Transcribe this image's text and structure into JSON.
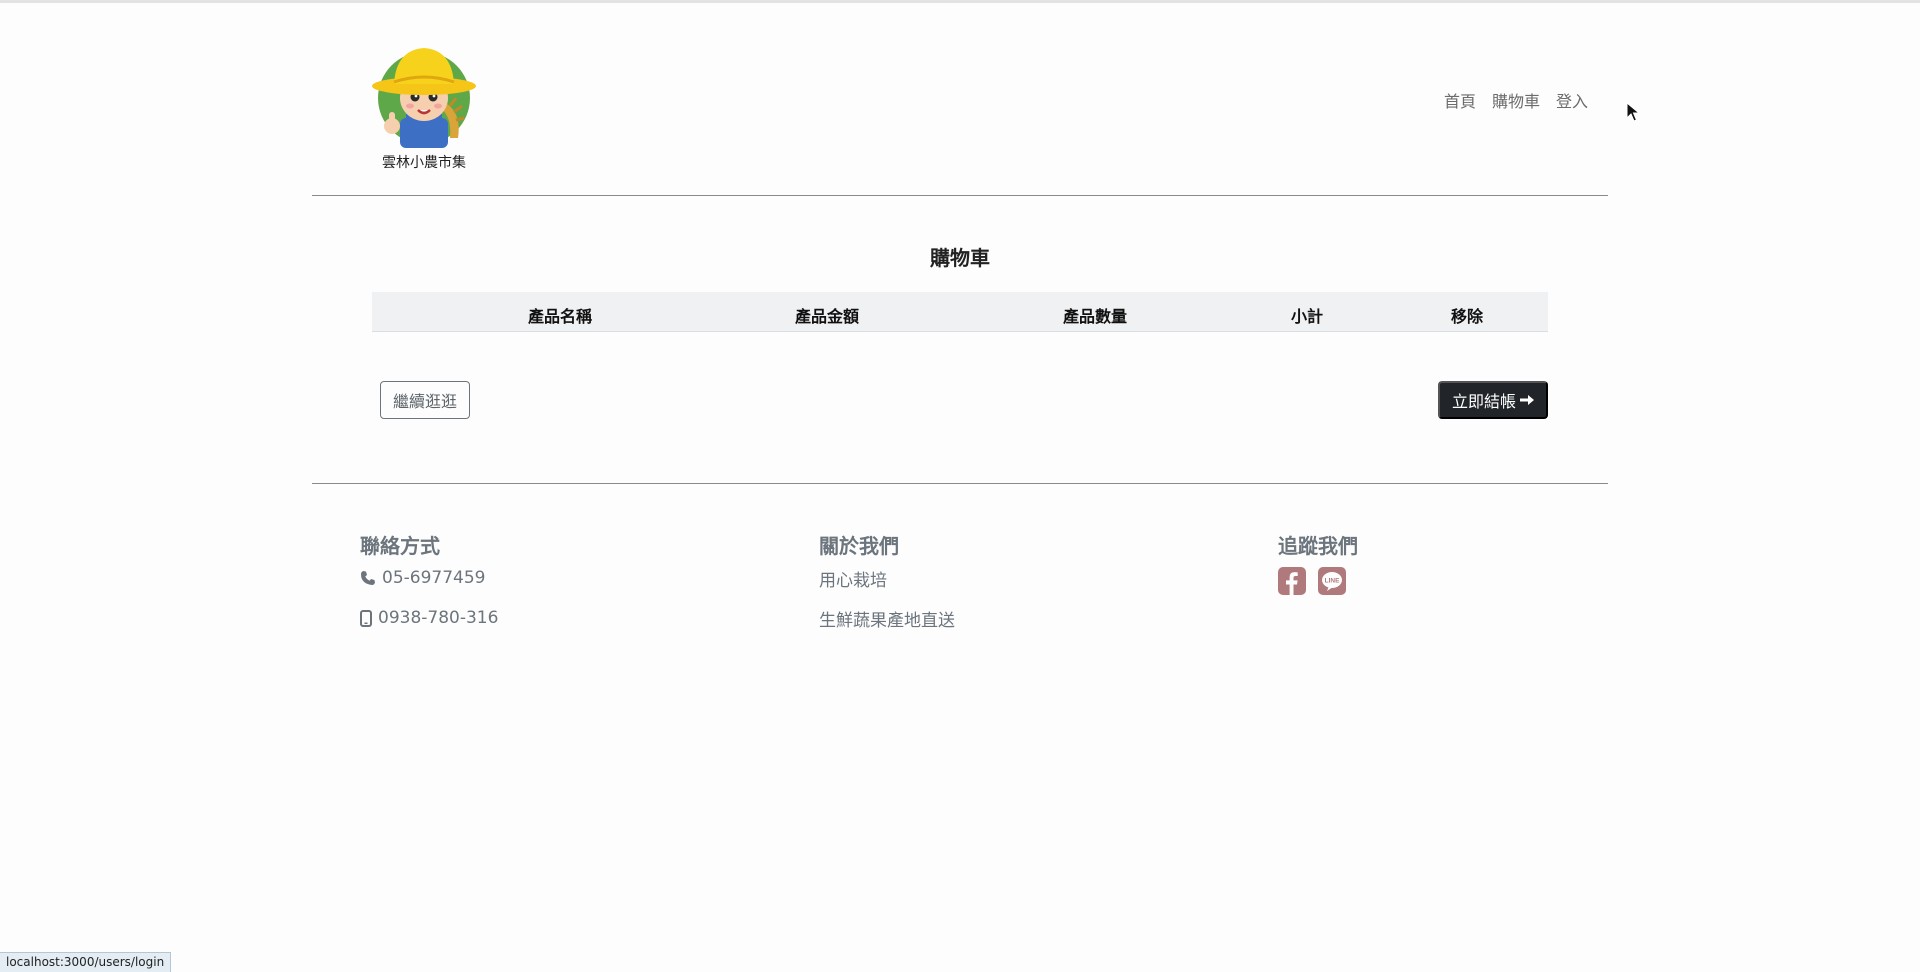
{
  "brand": {
    "name": "雲林小農市集"
  },
  "nav": {
    "home": "首頁",
    "cart": "購物車",
    "login": "登入"
  },
  "cart": {
    "title": "購物車",
    "columns": [
      "產品名稱",
      "產品金額",
      "產品數量",
      "小計",
      "移除"
    ],
    "continue_label": "繼續逛逛",
    "checkout_label": "立即結帳"
  },
  "footer": {
    "contact": {
      "title": "聯絡方式",
      "phone": "05-6977459",
      "mobile": "0938-780-316"
    },
    "about": {
      "title": "關於我們",
      "line1": "用心栽培",
      "line2": "生鮮蔬果產地直送"
    },
    "follow": {
      "title": "追蹤我們",
      "icons": [
        "facebook-icon",
        "line-icon"
      ]
    }
  },
  "status_bar": {
    "url": "localhost:3000/users/login"
  },
  "colors": {
    "accent": "#212529",
    "social": "#b07a7d",
    "muted": "#6c757d"
  }
}
